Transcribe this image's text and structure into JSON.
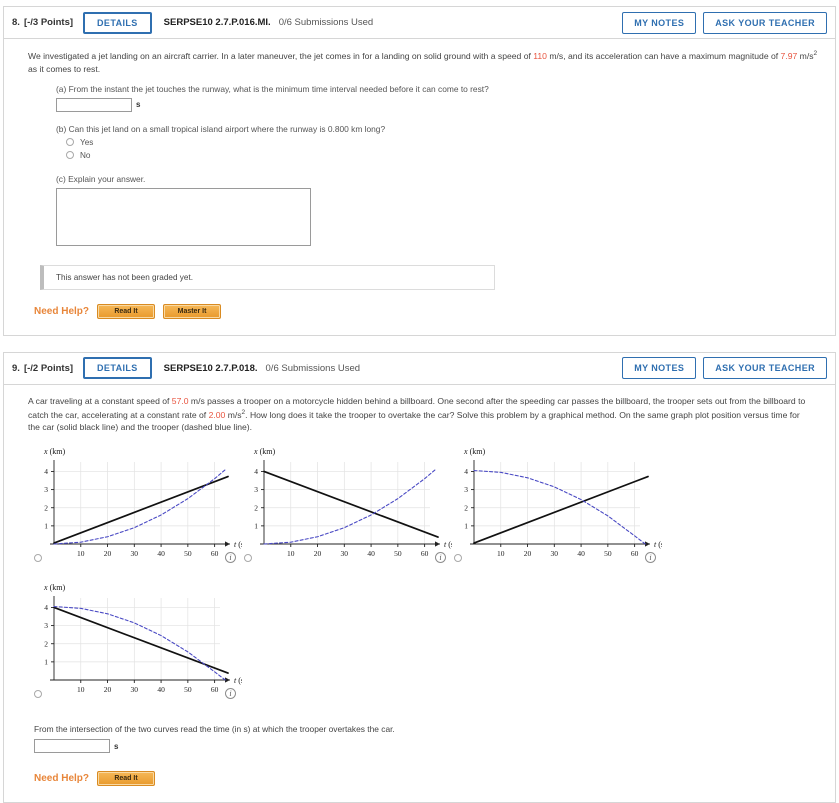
{
  "questions": [
    {
      "number": "8.",
      "points": "[-/3 Points]",
      "details_label": "DETAILS",
      "code": "SERPSE10 2.7.P.016.MI.",
      "submissions": "0/6 Submissions Used",
      "my_notes_label": "MY NOTES",
      "ask_teacher_label": "ASK YOUR TEACHER",
      "stem_part1": "We investigated a jet landing on an aircraft carrier. In a later maneuver, the jet comes in for a landing on solid ground with a speed of ",
      "stem_value1": "110",
      "stem_part2": " m/s, and its acceleration can have a maximum magnitude of ",
      "stem_value2": "7.97",
      "stem_part3": " m/s",
      "stem_exp": "2",
      "stem_part4": " as it comes to rest.",
      "part_a_label": "(a) From the instant the jet touches the runway, what is the minimum time interval needed before it can come to rest?",
      "part_a_value": "",
      "part_a_unit": "s",
      "part_b_label": "(b) Can this jet land on a small tropical island airport where the runway is 0.800 km long?",
      "part_b_options": [
        "Yes",
        "No"
      ],
      "part_c_label": "(c) Explain your answer.",
      "part_c_value": "",
      "graded_note": "This answer has not been graded yet.",
      "need_help_label": "Need Help?",
      "help_buttons": [
        "Read It",
        "Master It"
      ]
    },
    {
      "number": "9.",
      "points": "[-/2 Points]",
      "details_label": "DETAILS",
      "code": "SERPSE10 2.7.P.018.",
      "submissions": "0/6 Submissions Used",
      "my_notes_label": "MY NOTES",
      "ask_teacher_label": "ASK YOUR TEACHER",
      "stem_part1": "A car traveling at a constant speed of ",
      "stem_value1": "57.0",
      "stem_part2": " m/s passes a trooper on a motorcycle hidden behind a billboard. One second after the speeding car passes the billboard, the trooper sets out from the billboard to catch the car, accelerating at a constant rate of ",
      "stem_value2": "2.00",
      "stem_part3": " m/s",
      "stem_exp": "2",
      "stem_part4": ". How long does it take the trooper to overtake the car? Solve this problem by a graphical method. On the same graph plot position versus time for the car (solid black line) and the trooper (dashed blue line).",
      "final_question": "From the intersection of the two curves read the time (in s) at which the trooper overtakes the car.",
      "final_value": "",
      "final_unit": "s",
      "need_help_label": "Need Help?",
      "help_buttons": [
        "Read It"
      ],
      "info_icon_label": "i"
    }
  ],
  "chart_data": [
    {
      "type": "line",
      "title": "",
      "xlabel": "t  (s)",
      "ylabel": "x  (km)",
      "xlim": [
        0,
        65
      ],
      "ylim": [
        0,
        4.3
      ],
      "xticks": [
        10,
        20,
        30,
        40,
        50,
        60
      ],
      "yticks": [
        1,
        2,
        3,
        4
      ],
      "grid": true,
      "series": [
        {
          "name": "car (solid black line)",
          "style": "solid",
          "color": "#111111",
          "x": [
            0,
            65
          ],
          "y": [
            0.05,
            3.72
          ]
        },
        {
          "name": "trooper (dashed blue line)",
          "style": "dashed",
          "color": "#4a4ac4",
          "x": [
            0,
            10,
            20,
            30,
            40,
            50,
            60,
            64
          ],
          "y": [
            0.0,
            0.1,
            0.4,
            0.9,
            1.6,
            2.5,
            3.6,
            4.1
          ]
        }
      ]
    },
    {
      "type": "line",
      "title": "",
      "xlabel": "t  (s)",
      "ylabel": "x  (km)",
      "xlim": [
        0,
        65
      ],
      "ylim": [
        0,
        4.3
      ],
      "xticks": [
        10,
        20,
        30,
        40,
        50,
        60
      ],
      "yticks": [
        1,
        2,
        3,
        4
      ],
      "grid": true,
      "series": [
        {
          "name": "car (solid black line)",
          "style": "solid",
          "color": "#111111",
          "x": [
            0,
            65
          ],
          "y": [
            4.0,
            0.38
          ]
        },
        {
          "name": "trooper (dashed blue line)",
          "style": "dashed",
          "color": "#4a4ac4",
          "x": [
            0,
            10,
            20,
            30,
            40,
            50,
            60,
            64
          ],
          "y": [
            0.0,
            0.1,
            0.4,
            0.9,
            1.6,
            2.5,
            3.6,
            4.1
          ]
        }
      ]
    },
    {
      "type": "line",
      "title": "",
      "xlabel": "t  (s)",
      "ylabel": "x  (km)",
      "xlim": [
        0,
        65
      ],
      "ylim": [
        0,
        4.3
      ],
      "xticks": [
        10,
        20,
        30,
        40,
        50,
        60
      ],
      "yticks": [
        1,
        2,
        3,
        4
      ],
      "grid": true,
      "series": [
        {
          "name": "car (solid black line)",
          "style": "solid",
          "color": "#111111",
          "x": [
            0,
            65
          ],
          "y": [
            0.05,
            3.72
          ]
        },
        {
          "name": "trooper (dashed blue line)",
          "style": "dashed",
          "color": "#4a4ac4",
          "x": [
            0,
            10,
            20,
            30,
            40,
            50,
            60,
            64
          ],
          "y": [
            4.05,
            3.95,
            3.65,
            3.15,
            2.45,
            1.55,
            0.45,
            0.0
          ]
        }
      ]
    },
    {
      "type": "line",
      "title": "",
      "xlabel": "t  (s)",
      "ylabel": "x  (km)",
      "xlim": [
        0,
        65
      ],
      "ylim": [
        0,
        4.3
      ],
      "xticks": [
        10,
        20,
        30,
        40,
        50,
        60
      ],
      "yticks": [
        1,
        2,
        3,
        4
      ],
      "grid": true,
      "series": [
        {
          "name": "car (solid black line)",
          "style": "solid",
          "color": "#111111",
          "x": [
            0,
            65
          ],
          "y": [
            4.0,
            0.38
          ]
        },
        {
          "name": "trooper (dashed blue line)",
          "style": "dashed",
          "color": "#4a4ac4",
          "x": [
            0,
            10,
            20,
            30,
            40,
            50,
            60,
            64
          ],
          "y": [
            4.05,
            3.95,
            3.65,
            3.15,
            2.45,
            1.55,
            0.45,
            0.0
          ]
        }
      ]
    }
  ],
  "colors": {
    "accent_blue": "#2f6fb0",
    "highlight_red": "#e8543f",
    "help_orange": "#e8863a",
    "curve_blue": "#4a4ac4",
    "curve_black": "#111111"
  }
}
